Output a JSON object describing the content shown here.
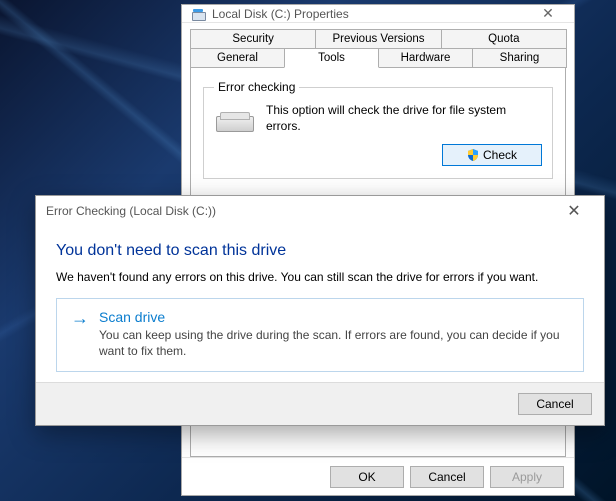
{
  "props": {
    "title": "Local Disk (C:) Properties",
    "close": "✕",
    "tabs_row1": [
      "Security",
      "Previous Versions",
      "Quota"
    ],
    "tabs_row2": [
      "General",
      "Tools",
      "Hardware",
      "Sharing"
    ],
    "active_tab": "Tools",
    "errorchk": {
      "legend": "Error checking",
      "desc": "This option will check the drive for file system errors.",
      "button": "Check"
    },
    "buttons": {
      "ok": "OK",
      "cancel": "Cancel",
      "apply": "Apply"
    }
  },
  "dialog": {
    "title": "Error Checking (Local Disk (C:))",
    "close": "✕",
    "heading": "You don't need to scan this drive",
    "message": "We haven't found any errors on this drive. You can still scan the drive for errors if you want.",
    "option": {
      "title": "Scan drive",
      "desc": "You can keep using the drive during the scan. If errors are found, you can decide if you want to fix them."
    },
    "cancel": "Cancel"
  }
}
